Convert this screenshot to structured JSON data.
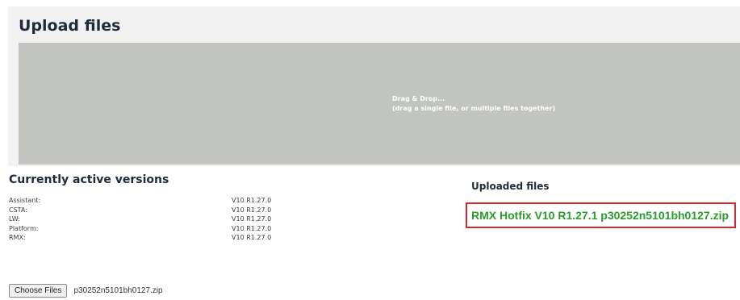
{
  "upload": {
    "title": "Upload files",
    "drop_zone": {
      "line1": "Drag & Drop...",
      "line2": "(drag a single file, or multiple files together)"
    }
  },
  "versions": {
    "title": "Currently active versions",
    "items": [
      {
        "label": "Assistant:",
        "value": "V10 R1.27.0"
      },
      {
        "label": "CSTA:",
        "value": "V10 R1.27.0"
      },
      {
        "label": "LW:",
        "value": "V10 R1.27.0"
      },
      {
        "label": "Platform:",
        "value": "V10 R1.27.0"
      },
      {
        "label": "RMX:",
        "value": "V10 R1.27.0"
      }
    ]
  },
  "uploaded": {
    "title": "Uploaded files",
    "file_name": "RMX Hotfix V10 R1.27.1 p30252n5101bh0127.zip"
  },
  "file_picker": {
    "button_label": "Choose Files",
    "chosen_file": "p30252n5101bh0127.zip"
  },
  "colors": {
    "panel_background": "#f2f2f2",
    "drop_zone": "#c2c5bf",
    "highlight_border": "#d9252c",
    "file_link": "#2c9a2c"
  }
}
